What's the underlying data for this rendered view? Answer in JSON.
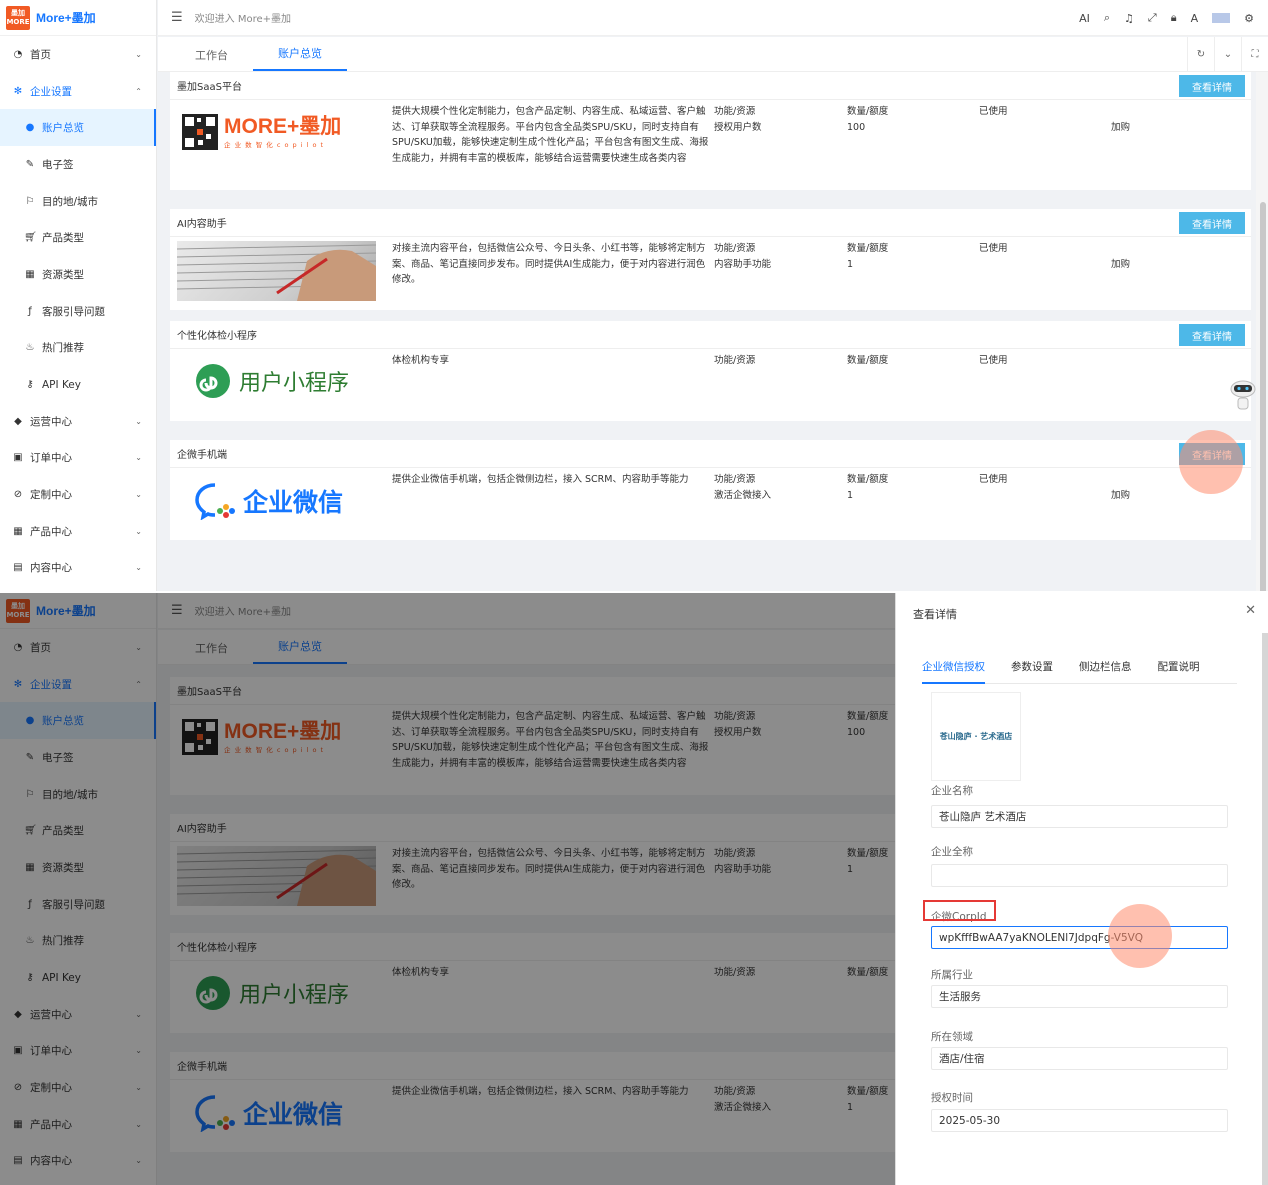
{
  "app": {
    "logo_badge": "墨加\nMORE+",
    "logo_text": "More+墨加",
    "welcome": "欢迎进入 More+墨加"
  },
  "tools": [
    "AI",
    "search-icon",
    "bell-icon",
    "fullscreen-icon",
    "lock-icon",
    "translate-icon",
    "avatar",
    "settings-icon"
  ],
  "tabs": [
    "工作台",
    "账户总览"
  ],
  "nav": [
    {
      "label": "首页",
      "icon": "dashboard-icon",
      "type": "top",
      "chev": "⌄"
    },
    {
      "label": "企业设置",
      "icon": "gear-icon",
      "type": "open",
      "chev": "⌃"
    },
    {
      "label": "账户总览",
      "icon": "dot-icon",
      "type": "active"
    },
    {
      "label": "电子签",
      "icon": "pen-icon",
      "type": "sub"
    },
    {
      "label": "目的地/城市",
      "icon": "flag-icon",
      "type": "sub"
    },
    {
      "label": "产品类型",
      "icon": "cart-icon",
      "type": "sub"
    },
    {
      "label": "资源类型",
      "icon": "grid-icon",
      "type": "sub"
    },
    {
      "label": "客服引导问题",
      "icon": "function-icon",
      "type": "sub"
    },
    {
      "label": "热门推荐",
      "icon": "fire-icon",
      "type": "sub"
    },
    {
      "label": "API Key",
      "icon": "key-icon",
      "type": "sub"
    },
    {
      "label": "运营中心",
      "icon": "android-icon",
      "type": "top",
      "chev": "⌄"
    },
    {
      "label": "订单中心",
      "icon": "order-icon",
      "type": "top",
      "chev": "⌄"
    },
    {
      "label": "定制中心",
      "icon": "compass-icon",
      "type": "top",
      "chev": "⌄"
    },
    {
      "label": "产品中心",
      "icon": "grid-icon",
      "type": "top",
      "chev": "⌄"
    },
    {
      "label": "内容中心",
      "icon": "content-icon",
      "type": "top",
      "chev": "⌄"
    }
  ],
  "cards": [
    {
      "title": "墨加SaaS平台",
      "btn": "查看详情",
      "logo": "more",
      "logo_main": "MORE+墨加",
      "logo_sub": "企 业 数 智 化 c o p i l o t",
      "desc": "提供大规模个性化定制能力，包含产品定制、内容生成、私域运营、客户触达、订单获取等全流程服务。平台内包含全品类SPU/SKU，同时支持自有SPU/SKU加载，能够快速定制生成个性化产品；平台包含有图文生成、海报生成能力，并拥有丰富的模板库，能够结合运营需要快速生成各类内容",
      "func": [
        "功能/资源",
        "授权用户数"
      ],
      "qty": [
        "数量/额度",
        "100"
      ],
      "used": [
        "已使用"
      ],
      "action": "加购"
    },
    {
      "title": "AI内容助手",
      "btn": "查看详情",
      "logo": "photo",
      "desc": "对接主流内容平台，包括微信公众号、今日头条、小红书等，能够将定制方案、商品、笔记直接同步发布。同时提供AI生成能力，便于对内容进行润色修改。",
      "func": [
        "功能/资源",
        "内容助手功能"
      ],
      "qty": [
        "数量/额度",
        "1"
      ],
      "used": [
        "已使用"
      ],
      "action": "加购"
    },
    {
      "title": "个性化体检小程序",
      "btn": "查看详情",
      "logo": "mini",
      "logo_main": "用户小程序",
      "desc": "体检机构专享",
      "func": [
        "功能/资源"
      ],
      "qty": [
        "数量/额度"
      ],
      "used": [
        "已使用"
      ],
      "action": ""
    },
    {
      "title": "企微手机端",
      "btn": "查看详情",
      "logo": "wework",
      "logo_main": "企业微信",
      "desc": "提供企业微信手机端，包括企微侧边栏，接入 SCRM、内容助手等能力",
      "func": [
        "功能/资源",
        "激活企微接入"
      ],
      "qty": [
        "数量/额度",
        "1"
      ],
      "used": [
        "已使用"
      ],
      "action": "加购"
    }
  ],
  "drawer": {
    "title": "查看详情",
    "tabs": [
      "企业微信授权",
      "参数设置",
      "侧边栏信息",
      "配置说明"
    ],
    "logo_text": "苍山隐庐 · 艺术酒店",
    "fields": [
      {
        "label": "企业名称",
        "value": "苍山隐庐 艺术酒店"
      },
      {
        "label": "企业全称",
        "value": ""
      },
      {
        "label": "企微CorpId",
        "value": "wpKfffBwAA7yaKNOLENl7JdpqFg-V5VQ"
      },
      {
        "label": "所属行业",
        "value": "生活服务"
      },
      {
        "label": "所在领域",
        "value": "酒店/住宿"
      },
      {
        "label": "授权时间",
        "value": "2025-05-30"
      }
    ]
  },
  "colors": {
    "primary": "#1677ff",
    "button": "#4db8e8",
    "brand": "#f15a24",
    "highlight": "#e53935"
  }
}
